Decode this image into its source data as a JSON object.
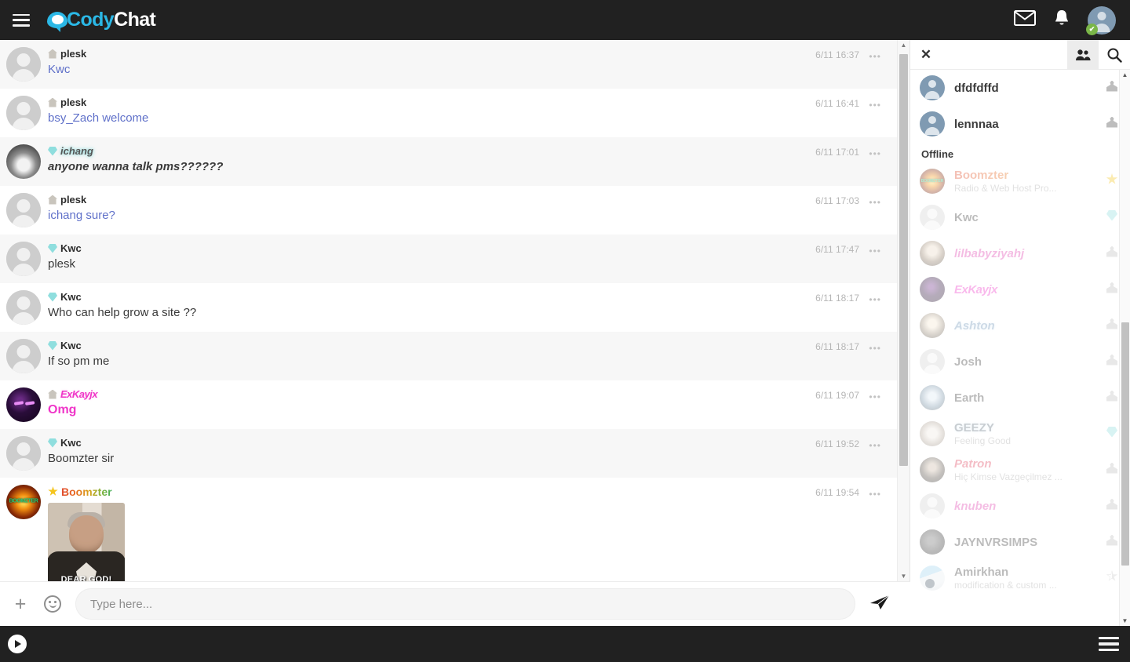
{
  "topbar": {
    "menu_icon": "hamburger-icon",
    "logo_cody": "Cody",
    "logo_chat": "Chat",
    "mail_icon": "envelope-icon",
    "bell_icon": "bell-icon",
    "avatar_icon": "user-avatar",
    "status_check": "✔"
  },
  "chat": {
    "messages": [
      {
        "avatar": "default",
        "badge": "member",
        "name": "plesk",
        "name_style": "plain",
        "text": "Kwc",
        "text_style": "blue",
        "time": "6/11 16:37",
        "menu": "•••",
        "row": "alt"
      },
      {
        "avatar": "default",
        "badge": "member",
        "name": "plesk",
        "name_style": "plain",
        "text": "bsy_Zach welcome",
        "text_style": "blue",
        "time": "6/11 16:41",
        "menu": "•••",
        "row": "plain"
      },
      {
        "avatar": "ichang",
        "badge": "diamond",
        "name": "ichang",
        "name_style": "ichang",
        "text": "anyone wanna talk pms??????",
        "text_style": "boldital",
        "time": "6/11 17:01",
        "menu": "•••",
        "row": "alt"
      },
      {
        "avatar": "default",
        "badge": "member",
        "name": "plesk",
        "name_style": "plain",
        "text": "ichang sure?",
        "text_style": "blue",
        "time": "6/11 17:03",
        "menu": "•••",
        "row": "plain"
      },
      {
        "avatar": "default",
        "badge": "diamond",
        "name": "Kwc",
        "name_style": "plain",
        "text": "plesk",
        "text_style": "normal",
        "time": "6/11 17:47",
        "menu": "•••",
        "row": "alt"
      },
      {
        "avatar": "default",
        "badge": "diamond",
        "name": "Kwc",
        "name_style": "plain",
        "text": "Who can help grow a site ??",
        "text_style": "normal",
        "time": "6/11 18:17",
        "menu": "•••",
        "row": "plain"
      },
      {
        "avatar": "default",
        "badge": "diamond",
        "name": "Kwc",
        "name_style": "plain",
        "text": "If so pm me",
        "text_style": "normal",
        "time": "6/11 18:17",
        "menu": "•••",
        "row": "alt"
      },
      {
        "avatar": "dark",
        "badge": "member",
        "name": "ExKayjx",
        "name_style": "exkay",
        "text": "Omg",
        "text_style": "magenta",
        "time": "6/11 19:07",
        "menu": "•••",
        "row": "plain"
      },
      {
        "avatar": "default",
        "badge": "diamond",
        "name": "Kwc",
        "name_style": "plain",
        "text": "Boomzter sir",
        "text_style": "normal",
        "time": "6/11 19:52",
        "menu": "•••",
        "row": "alt"
      },
      {
        "avatar": "boom",
        "avatar_text": "BOOMZTER",
        "badge": "star",
        "name": "Boomzter",
        "name_style": "boom",
        "text": "",
        "text_style": "normal",
        "time": "6/11 19:54",
        "menu": "•••",
        "row": "plain",
        "image_caption": "DEAR GOD!"
      }
    ],
    "scroll_up": "▲",
    "scroll_down": "▼"
  },
  "composer": {
    "plus_icon": "plus-icon",
    "emoji_icon": "smiley-icon",
    "placeholder": "Type here...",
    "value": "",
    "send_icon": "send-icon"
  },
  "sidebar": {
    "close_icon": "✕",
    "users_tab_icon": "users-icon",
    "search_tab_icon": "search-icon",
    "online_users": [
      {
        "avatar": "blue",
        "name": "dfdfdffd",
        "sub": "",
        "badge": "person"
      },
      {
        "avatar": "blue",
        "name": "lennnaa",
        "sub": "",
        "badge": "person"
      }
    ],
    "offline_label": "Offline",
    "offline_users": [
      {
        "avatar": "boom",
        "avatar_text": "BOOMZTER",
        "name": "Boomzter",
        "name_style": "n-boom",
        "sub": "Radio & Web Host Pro...",
        "badge": "star-yellow"
      },
      {
        "avatar": "gray",
        "name": "Kwc",
        "name_style": "plain",
        "sub": "",
        "badge": "diamond"
      },
      {
        "avatar": "girl1",
        "name": "lilbabyziyahj",
        "name_style": "n-pink",
        "sub": "",
        "badge": "person"
      },
      {
        "avatar": "dark2",
        "name": "ExKayjx",
        "name_style": "n-magenta",
        "sub": "",
        "badge": "person"
      },
      {
        "avatar": "anime",
        "name": "Ashton",
        "name_style": "n-ice",
        "sub": "",
        "badge": "person"
      },
      {
        "avatar": "gray",
        "name": "Josh",
        "name_style": "plain",
        "sub": "",
        "badge": "person"
      },
      {
        "avatar": "earth",
        "name": "Earth",
        "name_style": "plain",
        "sub": "",
        "badge": "person"
      },
      {
        "avatar": "dog",
        "name": "GEEZY",
        "name_style": "n-geezy",
        "sub": "Feeling Good",
        "badge": "diamond"
      },
      {
        "avatar": "man",
        "name": "Patron",
        "name_style": "n-red",
        "sub": "Hiç Kimse Vazgeçilmez ...",
        "badge": "person"
      },
      {
        "avatar": "gray",
        "name": "knuben",
        "name_style": "n-pink",
        "sub": "",
        "badge": "person"
      },
      {
        "avatar": "crowd",
        "name": "JAYNVRSIMPS",
        "name_style": "plain",
        "sub": "",
        "badge": "person"
      },
      {
        "avatar": "desk",
        "name": "Amirkhan",
        "name_style": "plain",
        "sub": "modification & custom ...",
        "badge": "star-outline"
      }
    ],
    "scroll_up": "▲",
    "scroll_down": "▼"
  },
  "bottombar": {
    "play_icon": "play-icon",
    "menu_icon": "hamburger-icon"
  },
  "colors": {
    "brand_cyan": "#2bb8e6",
    "topbar_bg": "#212121",
    "link_blue": "#5f70c9",
    "magenta": "#ef35c8",
    "online_green": "#7ab648"
  }
}
